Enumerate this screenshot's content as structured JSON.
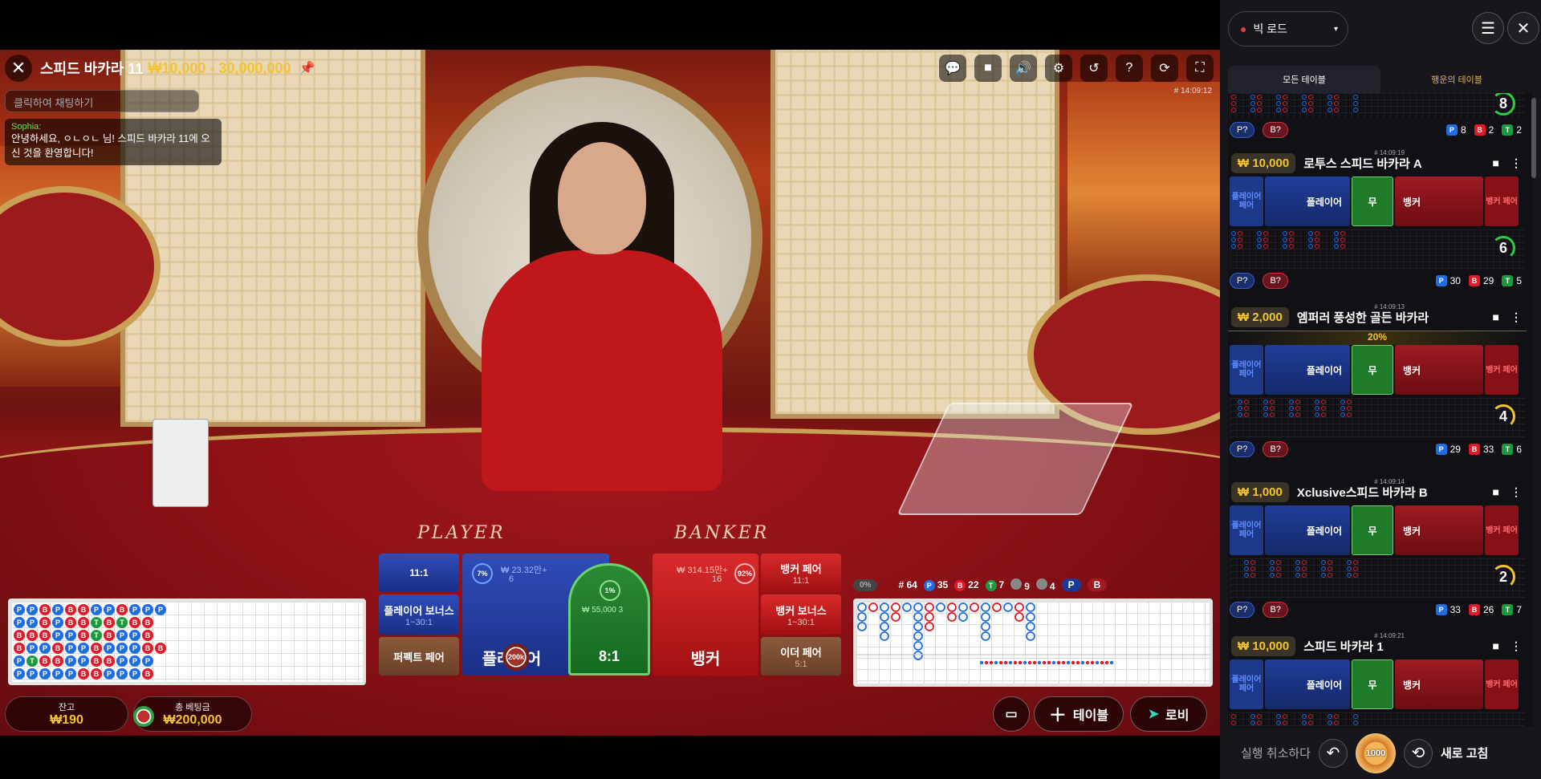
{
  "game": {
    "title": "스피드 바카라 11",
    "limits": "₩10,000 - 30,000,000",
    "timestamp": "# 14:09:12",
    "chat_placeholder": "클릭하여 채팅하기",
    "chat_user": "Sophia:",
    "chat_message": "안녕하세요, ㅇㄴㅇㄴ 님! 스피드 바카라 11에 오신 것을 환영합니다!",
    "felt_player": "PLAYER",
    "felt_banker": "BANKER"
  },
  "toolbar_icons": [
    "chat-icon",
    "video-icon",
    "sound-icon",
    "settings-icon",
    "history-icon",
    "help-icon",
    "rotate-icon",
    "fullscreen-icon"
  ],
  "bets": {
    "player_pair_odds": "11:1",
    "player_bonus": "플레이어 보너스",
    "player_bonus_odds": "1~30:1",
    "perfect_pair": "퍼펙트 페어",
    "player_pct": "7%",
    "player_amount": "₩ 23.32만+",
    "player_count": "6",
    "player_label": "플레이어",
    "chip_label": "200k",
    "tie_pct": "1%",
    "tie_amount": "₩ 55,000",
    "tie_count": "3",
    "tie_odds": "8:1",
    "banker_amount": "₩ 314.15만+",
    "banker_count": "16",
    "banker_pct": "92%",
    "banker_label": "뱅커",
    "banker_pair": "뱅커 페어",
    "banker_pair_odds": "11:1",
    "banker_bonus": "뱅커 보너스",
    "banker_bonus_odds": "1~30:1",
    "either_pair": "이더 페어",
    "either_pair_odds": "5:1"
  },
  "road_stats": {
    "toggle": "0%",
    "rounds": "# 64",
    "player": "35",
    "banker": "22",
    "tie": "7",
    "player_pair": "9",
    "banker_pair": "4",
    "p_label": "P",
    "b_label": "B",
    "t_label": "T"
  },
  "bead_left": [
    "PPBPBBPPBPPP",
    "PPBPBBTBTBB",
    "BBBPPBTBPPB",
    "BPPBPPBPPPBB",
    "PTBBPPBBPPP",
    "PPPPPBBPPPB"
  ],
  "balance": {
    "balance_label": "잔고",
    "balance_value": "₩190",
    "total_bet_label": "총 베팅금",
    "total_bet_value": "₩200,000"
  },
  "bottom_buttons": {
    "table": "테이블",
    "lobby": "로비"
  },
  "sidebar": {
    "view": "빅 로드",
    "tab_all": "모든 테이블",
    "tab_lucky": "행운의 테이블",
    "top_partial": {
      "ring": "8",
      "p_pill": "P?",
      "b_pill": "B?",
      "p": "8",
      "b": "2",
      "t": "2"
    },
    "cards": [
      {
        "ts": "# 14:09:19",
        "stake": "₩ 10,000",
        "name": "로투스 스피드 바카라 A",
        "ring": "6",
        "ring_color": "#2ecc40",
        "p": "30",
        "b": "29",
        "t": "5",
        "promo": ""
      },
      {
        "ts": "# 14:09:13",
        "stake": "₩ 2,000",
        "name": "엠퍼러 풍성한 골든 바카라",
        "ring": "4",
        "ring_color": "#f4c430",
        "p": "29",
        "b": "33",
        "t": "6",
        "promo": "20%"
      },
      {
        "ts": "# 14:09:14",
        "stake": "₩ 1,000",
        "name": "Xclusive스피드 바카라 B",
        "ring": "2",
        "ring_color": "#f4c430",
        "p": "33",
        "b": "26",
        "t": "7",
        "promo": ""
      },
      {
        "ts": "# 14:09:21",
        "stake": "₩ 10,000",
        "name": "스피드 바카라 1",
        "ring": "",
        "ring_color": "#2ecc40",
        "p": "",
        "b": "",
        "t": "",
        "promo": ""
      }
    ],
    "mini_labels": {
      "player_pair": "플레이어 페어",
      "player": "플레이어",
      "tie": "무",
      "banker": "뱅커",
      "banker_pair": "뱅커 페어",
      "p_pill": "P?",
      "b_pill": "B?"
    },
    "footer": {
      "undo": "실행 취소하다",
      "chip": "1000",
      "refresh": "새로 고침"
    }
  },
  "colors": {
    "accent_gold": "#f4c430",
    "player_blue": "#1f6de0",
    "banker_red": "#e01a28",
    "tie_green": "#1a9a3c"
  }
}
